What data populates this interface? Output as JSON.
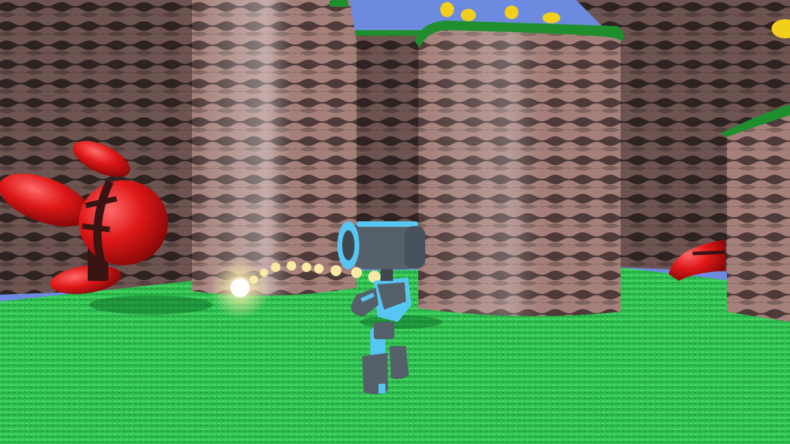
{
  "scene": {
    "type": "3d-platformer-viewport",
    "hud_text": []
  },
  "colors": {
    "sky": "#6c8be0",
    "grass_light": "#3fd35f",
    "grass_dark": "#18a03a",
    "rock_light": "#a5807b",
    "rock_dark": "#4e3a39",
    "grass_cap": "#1f8f2e",
    "coin": "#f2cf1a",
    "enemy_red": "#e01818",
    "enemy_dark": "#3a1313",
    "robot_body": "#55606b",
    "robot_accent": "#58c6f2",
    "projectile": "#fff6c9"
  },
  "entities": {
    "player": {
      "name": "robot-player"
    },
    "enemies": [
      {
        "name": "red-crab-enemy"
      },
      {
        "name": "red-crab-enemy-distant"
      }
    ],
    "coins_visible": 5,
    "projectile": {
      "name": "energy-shot",
      "trail_dots": 9
    }
  }
}
